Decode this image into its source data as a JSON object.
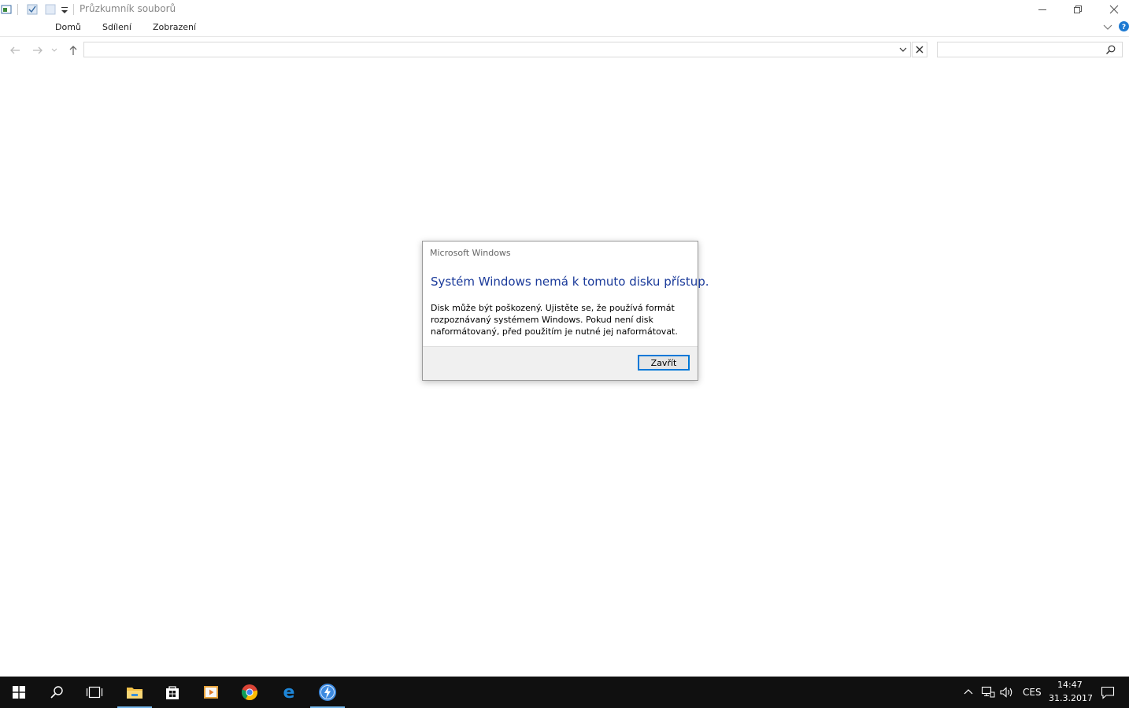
{
  "window": {
    "title": "Průzkumník souborů",
    "buttons": {
      "minimize": "—",
      "restore": "❐",
      "close": "✕"
    }
  },
  "ribbon": {
    "tabs": [
      {
        "label": "Domů"
      },
      {
        "label": "Sdílení"
      },
      {
        "label": "Zobrazení"
      }
    ]
  },
  "address_bar": {
    "value": ""
  },
  "search": {
    "placeholder": ""
  },
  "dialog": {
    "caption": "Microsoft Windows",
    "heading": "Systém Windows nemá k tomuto disku přístup.",
    "body_lines": [
      "Disk může být poškozený. Ujistěte se, že používá formát",
      "rozpoznávaný systémem Windows. Pokud není disk",
      "naformátovaný, před použitím je nutné jej naformátovat."
    ],
    "button": "Zavřít"
  },
  "taskbar": {
    "pinned": [
      "start-icon",
      "search-icon",
      "task-view-icon",
      "file-explorer-icon",
      "store-icon",
      "media-player-icon",
      "chrome-icon",
      "edge-icon",
      "thunderbolt-icon"
    ],
    "tray": {
      "language": "CES",
      "time": "14:47",
      "date": "31.3.2017"
    }
  },
  "colors": {
    "dialog_heading": "#1a3a9a",
    "taskbar": "#101010",
    "accent": "#0078d7"
  }
}
